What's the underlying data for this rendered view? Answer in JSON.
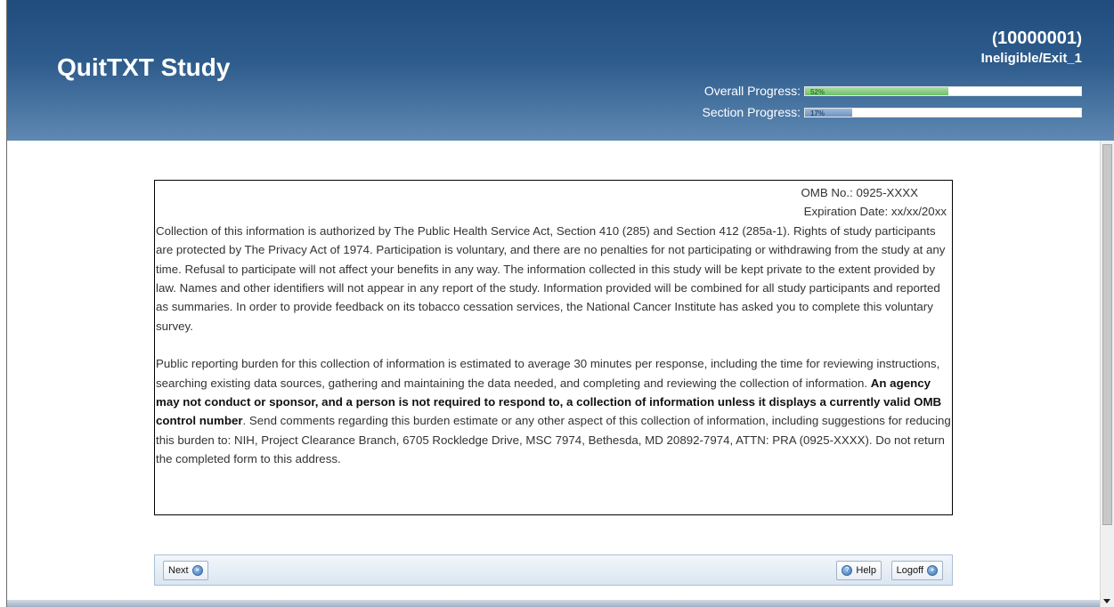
{
  "header": {
    "title": "QuitTXT Study",
    "participant_id_open": "(",
    "participant_id": "10000001",
    "participant_id_close": ")",
    "status": "Ineligible/Exit_1",
    "overall_progress": {
      "label": "Overall Progress:",
      "value_text": "52%",
      "value": 52,
      "color": "#6fbf69"
    },
    "section_progress": {
      "label": "Section Progress:",
      "value_text": "17%",
      "value": 17,
      "color": "#6d94c0"
    }
  },
  "consent": {
    "omb_no": "OMB No.: 0925-XXXX",
    "expiration": "Expiration  Date:  xx/xx/20xx",
    "paragraph1": "Collection of this information is authorized by The Public Health Service Act, Section 410 (285) and Section 412 (285a-1). Rights of study participants are protected by The Privacy Act of 1974. Participation is voluntary, and there are no penalties for not participating or withdrawing from the study at any time. Refusal to participate will not affect your benefits in any way. The information collected in this study will be kept private to the extent provided by law.  Names and other identifiers will not appear in any report of the study. Information provided will be combined for all study participants and reported as summaries.  In order to provide feedback on its tobacco cessation services, the National Cancer Institute has asked you to complete this voluntary survey.",
    "paragraph2_start": "Public reporting burden for this collection of information is estimated to average 30 minutes per response, including the time for reviewing instructions, searching existing data sources, gathering and maintaining the data needed, and completing and reviewing the collection of information. ",
    "paragraph2_bold": "An agency may not conduct or sponsor, and a person is not required to respond to, a collection of information unless it displays a currently valid OMB control number",
    "paragraph2_end": ". Send comments regarding this burden estimate or any other aspect of this collection of information, including suggestions for reducing this burden to: NIH, Project Clearance Branch, 6705 Rockledge Drive, MSC 7974, Bethesda, MD 20892-7974, ATTN: PRA (0925-XXXX). Do not return the completed form to this address."
  },
  "nav": {
    "next_label": "Next",
    "help_label": "Help",
    "logoff_label": "Logoff"
  },
  "colors": {
    "header_dark": "#1f4c7c",
    "header_light": "#5f89b3",
    "nav_bar": "#dbe6f1"
  }
}
